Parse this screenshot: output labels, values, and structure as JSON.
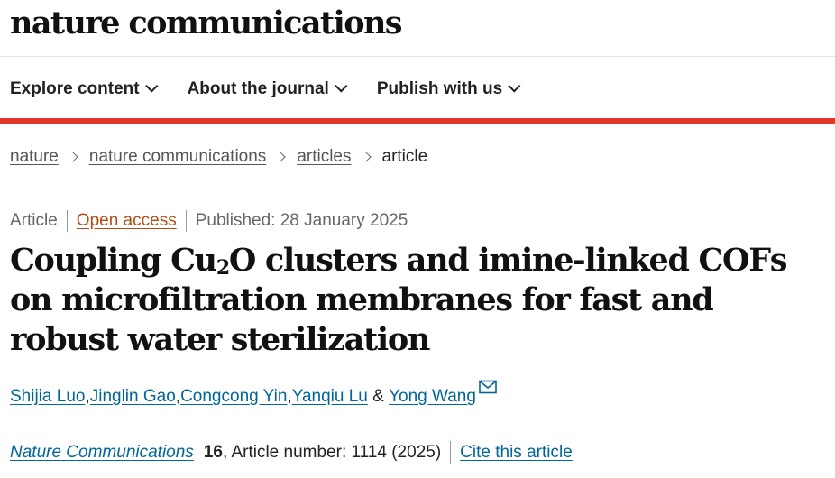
{
  "site": {
    "logo": "nature communications"
  },
  "nav": {
    "items": [
      {
        "label": "Explore content"
      },
      {
        "label": "About the journal"
      },
      {
        "label": "Publish with us"
      }
    ]
  },
  "breadcrumb": {
    "items": [
      "nature",
      "nature communications",
      "articles"
    ],
    "current": "article"
  },
  "meta": {
    "type": "Article",
    "access": "Open access",
    "published": "Published: 28 January 2025"
  },
  "article": {
    "title_part1": "Coupling Cu",
    "title_sub": "2",
    "title_part2": "O clusters and imine-linked COFs on microfiltration membranes for fast and robust water sterilization"
  },
  "authors": {
    "list": [
      "Shijia Luo",
      "Jinglin Gao",
      "Congcong Yin",
      "Yanqiu Lu"
    ],
    "last": "Yong Wang",
    "separator": ", ",
    "and": " & "
  },
  "citation": {
    "journal": "Nature Communications",
    "volume": "16",
    "rest": ", Article number: 1114 (2025)",
    "cite_label": "Cite this article"
  },
  "colors": {
    "accent_red": "#e0382c",
    "link_blue": "#006699",
    "open_access_orange": "#b24e15"
  }
}
